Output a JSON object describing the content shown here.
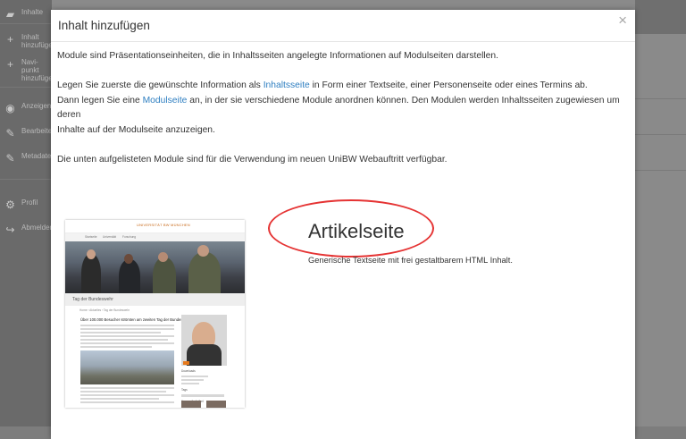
{
  "background": {
    "sidebar_items": [
      {
        "icon": "folder-icon",
        "label": "Inhalte"
      },
      {
        "icon": "plus-icon",
        "label": "Inhalt hinzufügen"
      },
      {
        "icon": "plus-icon",
        "label": "Navi-punkt hinzufügen"
      },
      {
        "icon": "eye-icon",
        "label": "Anzeigen"
      },
      {
        "icon": "pencil-icon",
        "label": "Bearbeiten"
      },
      {
        "icon": "pencil-icon",
        "label": "Metadaten"
      },
      {
        "icon": "gear-icon",
        "label": "Profil"
      },
      {
        "icon": "logout-icon",
        "label": "Abmelden"
      }
    ]
  },
  "modal": {
    "title": "Inhalt hinzufügen",
    "close_symbol": "×",
    "intro": {
      "p1": "Module sind Präsentationseinheiten, die in Inhaltsseiten angelegte Informationen auf Modulseiten darstellen.",
      "p2_before": "Legen Sie zuerste die gewünschte Information als ",
      "p2_link": "Inhaltsseite",
      "p2_after": " in Form einer Textseite, einer Personenseite oder eines Termins ab.",
      "p3_before": "Dann legen Sie eine ",
      "p3_link": "Modulseite",
      "p3_after": " an, in der sie verschiedene Module anordnen können. Den Modulen werden Inhaltsseiten zugewiesen um deren",
      "p3_line2": "Inhalte auf der Modulseite anzuzeigen.",
      "p4": "Die unten aufgelisteten Module sind für die Verwendung im neuen UniBW Webauftritt verfügbar."
    },
    "module": {
      "title": "Artikelseite",
      "description": "Generische Textseite mit frei gestaltbarem HTML Inhalt.",
      "highlight_color": "#e53333",
      "thumbnail": {
        "logo": "UNIVERSITÄT BW MÜNCHEN",
        "nav": [
          "Startseite",
          "Universität",
          "Forschung"
        ],
        "caption": "Tag der Bundeswehr",
        "breadcrumb": "Home › Aktuelles › Tag der Bundeswehr",
        "article_title": "Über 100.000 Besucher strömten am zweiten Tag der Bundeswehr",
        "sidebar_label_1": "Downloads",
        "sidebar_label_2": "Tags",
        "sidebar_label_3": "Verwandte Artikel"
      }
    }
  }
}
